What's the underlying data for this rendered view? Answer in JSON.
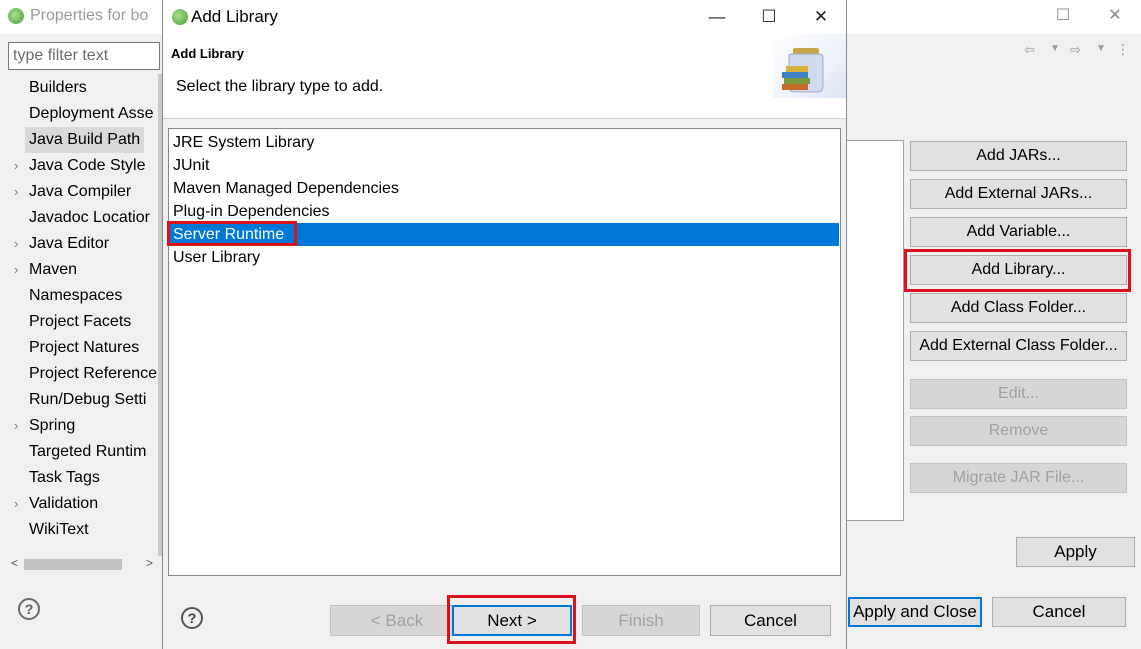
{
  "background_window": {
    "title": "Properties for bo",
    "filter_placeholder": "type filter text",
    "tree_items": [
      {
        "label": "Builders",
        "expandable": false,
        "selected": false
      },
      {
        "label": "Deployment Asse",
        "expandable": false,
        "selected": false
      },
      {
        "label": "Java Build Path",
        "expandable": false,
        "selected": true
      },
      {
        "label": "Java Code Style",
        "expandable": true,
        "selected": false
      },
      {
        "label": "Java Compiler",
        "expandable": true,
        "selected": false
      },
      {
        "label": "Javadoc Locatior",
        "expandable": false,
        "selected": false
      },
      {
        "label": "Java Editor",
        "expandable": true,
        "selected": false
      },
      {
        "label": "Maven",
        "expandable": true,
        "selected": false
      },
      {
        "label": "Namespaces",
        "expandable": false,
        "selected": false
      },
      {
        "label": "Project Facets",
        "expandable": false,
        "selected": false
      },
      {
        "label": "Project Natures",
        "expandable": false,
        "selected": false
      },
      {
        "label": "Project Reference",
        "expandable": false,
        "selected": false
      },
      {
        "label": "Run/Debug Setti",
        "expandable": false,
        "selected": false
      },
      {
        "label": "Spring",
        "expandable": true,
        "selected": false
      },
      {
        "label": "Targeted Runtim",
        "expandable": false,
        "selected": false
      },
      {
        "label": "Task Tags",
        "expandable": false,
        "selected": false
      },
      {
        "label": "Validation",
        "expandable": true,
        "selected": false
      },
      {
        "label": "WikiText",
        "expandable": false,
        "selected": false
      }
    ],
    "side_buttons": {
      "add_jars": "Add JARs...",
      "add_external_jars": "Add External JARs...",
      "add_variable": "Add Variable...",
      "add_library": "Add Library...",
      "add_class_folder": "Add Class Folder...",
      "add_external_class_folder": "Add External Class Folder...",
      "edit": "Edit...",
      "remove": "Remove",
      "migrate_jar": "Migrate JAR File..."
    },
    "apply": "Apply",
    "apply_and_close": "Apply and Close",
    "cancel": "Cancel"
  },
  "dialog": {
    "title": "Add Library",
    "header_title": "Add Library",
    "header_message": "Select the library type to add.",
    "library_types": [
      {
        "label": "JRE System Library",
        "selected": false
      },
      {
        "label": "JUnit",
        "selected": false
      },
      {
        "label": "Maven Managed Dependencies",
        "selected": false
      },
      {
        "label": "Plug-in Dependencies",
        "selected": false
      },
      {
        "label": "Server Runtime",
        "selected": true
      },
      {
        "label": "User Library",
        "selected": false
      }
    ],
    "buttons": {
      "back": "< Back",
      "next": "Next >",
      "finish": "Finish",
      "cancel": "Cancel"
    }
  },
  "colors": {
    "selection": "#0078d7",
    "highlight_box": "#d9121b"
  }
}
